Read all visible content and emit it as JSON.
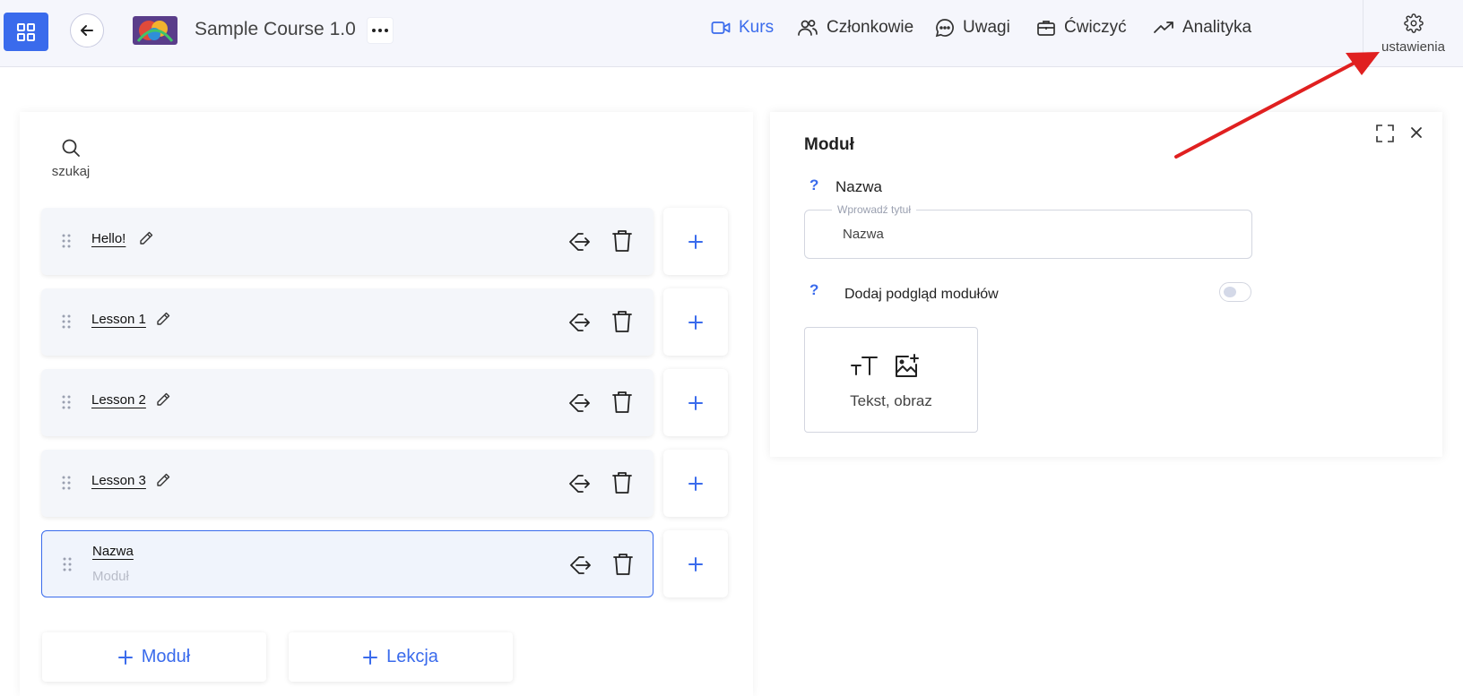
{
  "header": {
    "course_title": "Sample Course 1.0",
    "nav": [
      {
        "label": "Kurs",
        "icon": "video-icon",
        "active": true
      },
      {
        "label": "Członkowie",
        "icon": "members-icon",
        "active": false
      },
      {
        "label": "Uwagi",
        "icon": "chat-icon",
        "active": false
      },
      {
        "label": "Ćwiczyć",
        "icon": "briefcase-icon",
        "active": false
      },
      {
        "label": "Analityka",
        "icon": "trend-icon",
        "active": false
      }
    ],
    "settings_label": "ustawienia"
  },
  "left": {
    "search_label": "szukaj",
    "items": [
      {
        "title": "Hello!",
        "subtitle": ""
      },
      {
        "title": "Lesson 1",
        "subtitle": ""
      },
      {
        "title": "Lesson 2",
        "subtitle": ""
      },
      {
        "title": "Lesson 3",
        "subtitle": ""
      },
      {
        "title": "Nazwa",
        "subtitle": "Moduł"
      }
    ],
    "add_module_label": "Moduł",
    "add_lesson_label": "Lekcja"
  },
  "right": {
    "title": "Moduł",
    "name_label": "Nazwa",
    "name_help": "?",
    "input_legend": "Wprowadź tytuł",
    "input_value": "Nazwa",
    "preview_help": "?",
    "preview_label": "Dodaj podgląd modułów",
    "preview_toggle_on": false,
    "card_label": "Tekst, obraz"
  },
  "colors": {
    "accent": "#3a6bec",
    "annotation_arrow": "#e02020"
  }
}
